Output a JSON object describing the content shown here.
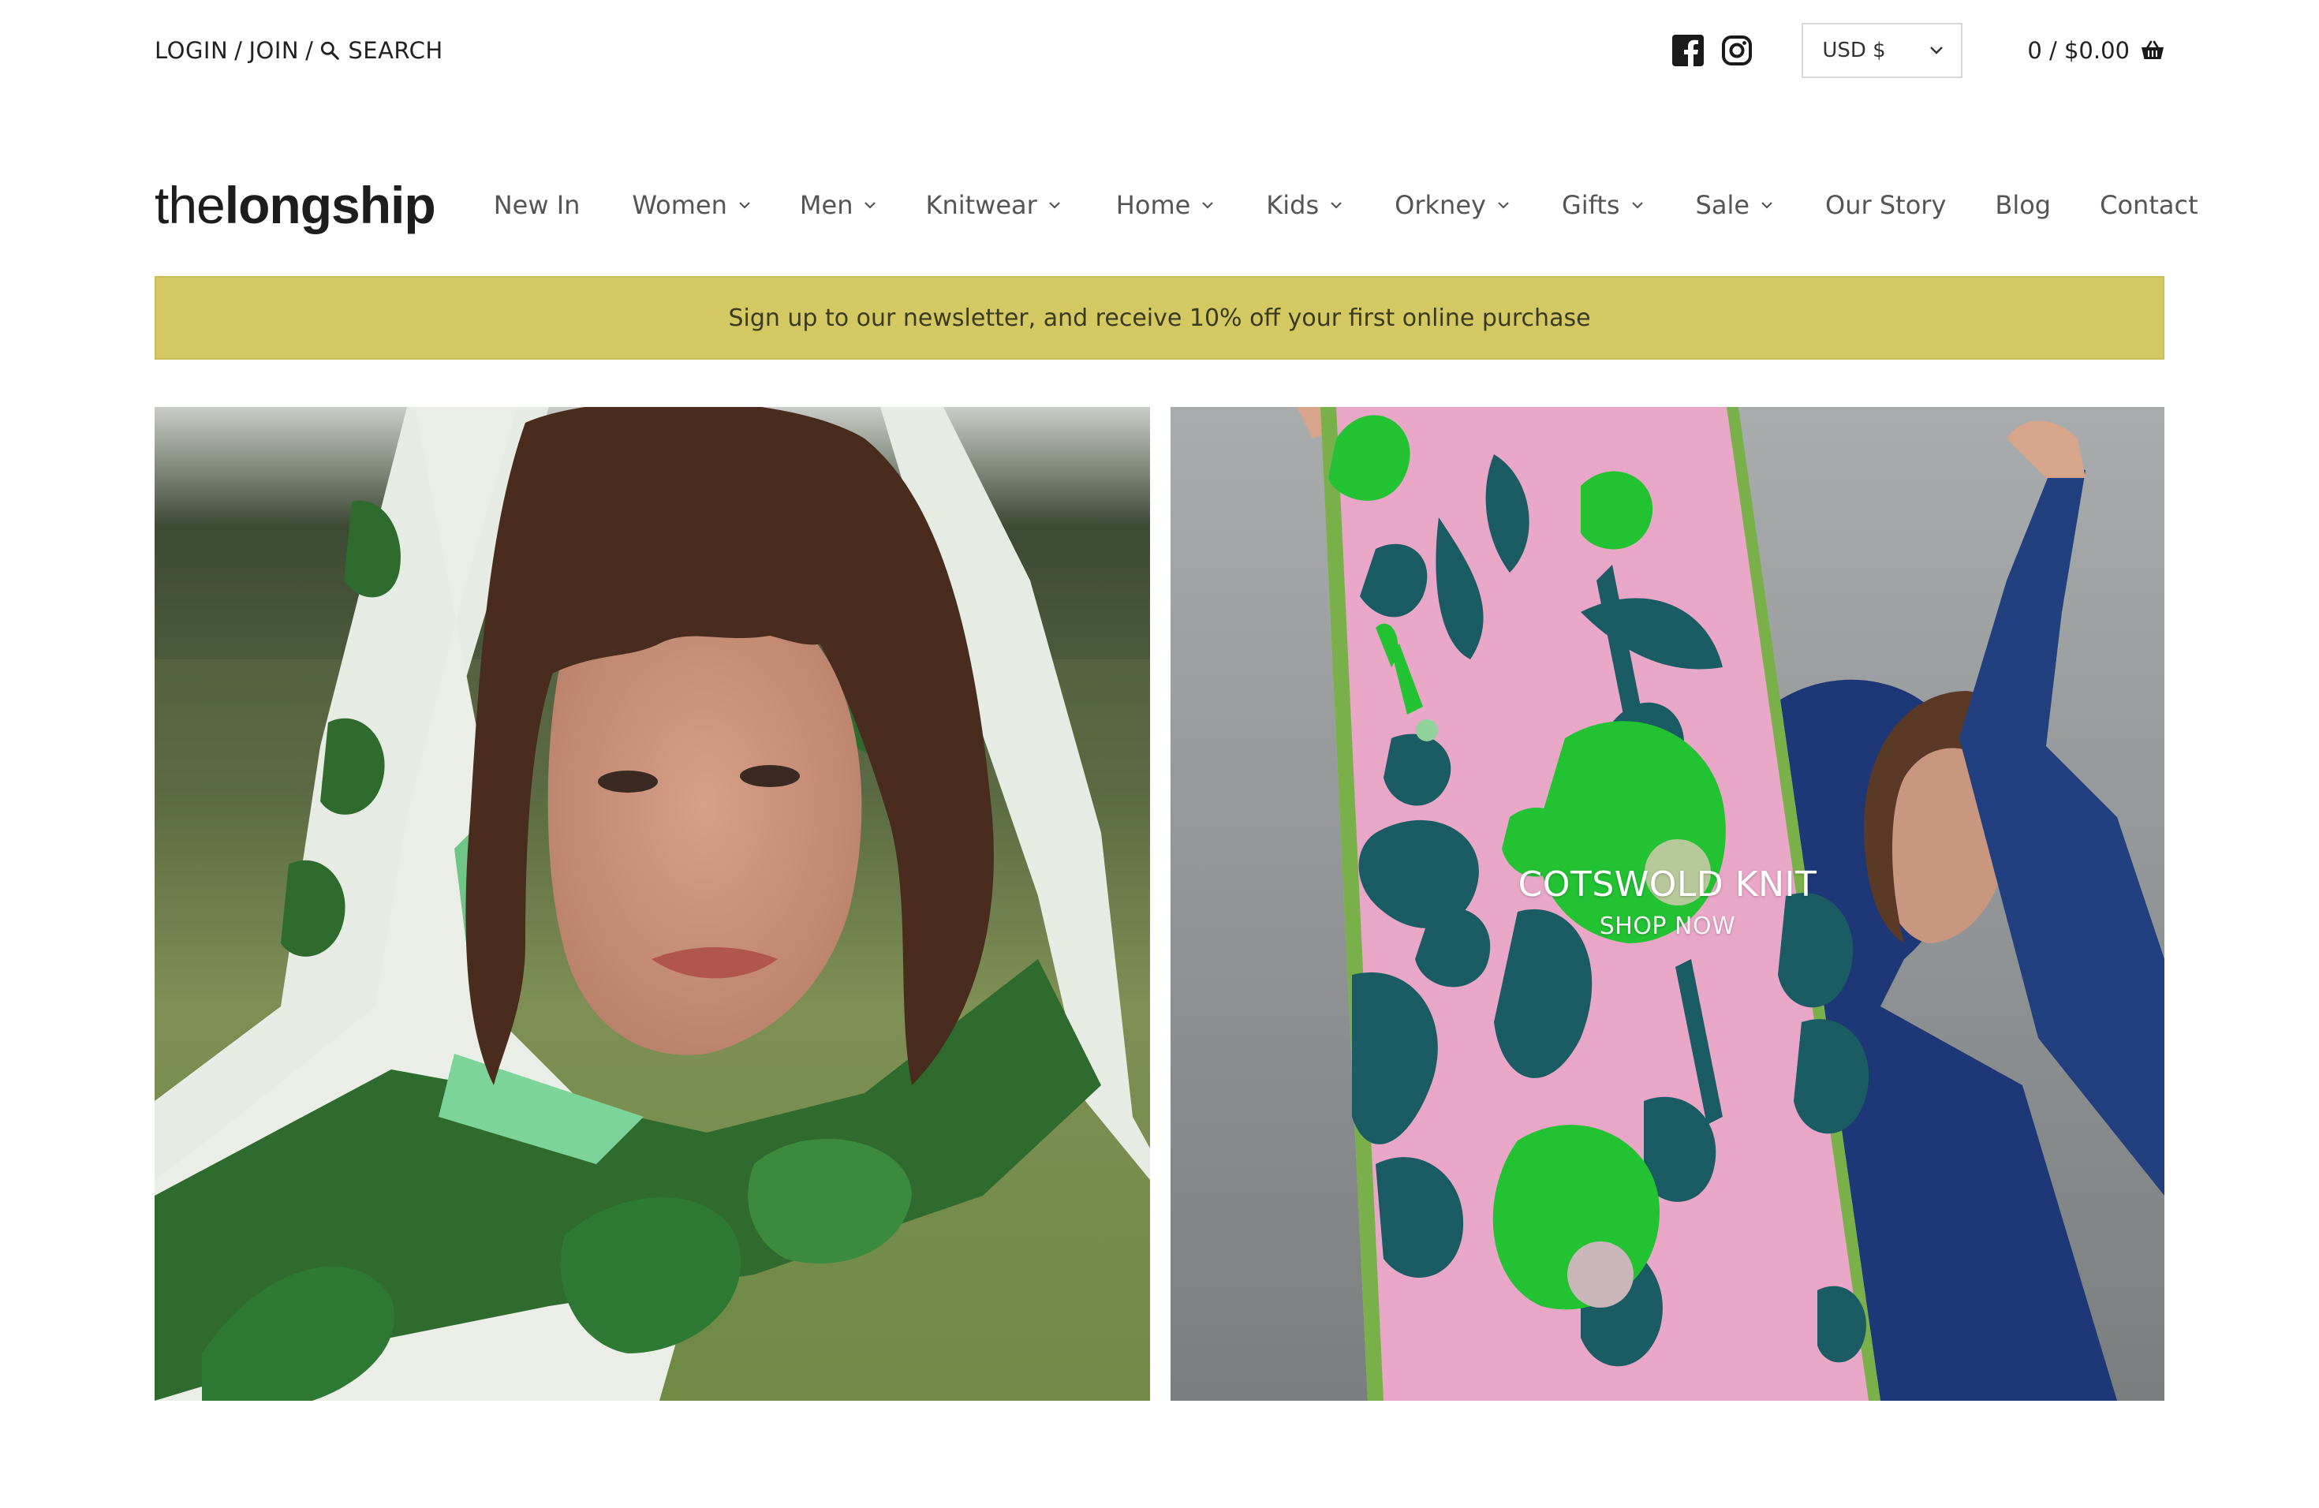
{
  "topbar": {
    "login": "LOGIN",
    "join": "JOIN",
    "search": "SEARCH",
    "currency": "USD $",
    "cart": "0 / $0.00"
  },
  "header": {
    "logo_light": "the",
    "logo_bold": "longship",
    "nav": [
      {
        "label": "New In",
        "dropdown": false
      },
      {
        "label": "Women",
        "dropdown": true
      },
      {
        "label": "Men",
        "dropdown": true
      },
      {
        "label": "Knitwear",
        "dropdown": true
      },
      {
        "label": "Home",
        "dropdown": true
      },
      {
        "label": "Kids",
        "dropdown": true
      },
      {
        "label": "Orkney",
        "dropdown": true
      },
      {
        "label": "Gifts",
        "dropdown": true
      },
      {
        "label": "Sale",
        "dropdown": true
      },
      {
        "label": "Our Story",
        "dropdown": false
      },
      {
        "label": "Blog",
        "dropdown": false
      },
      {
        "label": "Contact",
        "dropdown": false
      }
    ]
  },
  "banner": {
    "text": "Sign up to our newsletter, and receive 10% off your first online purchase",
    "color": "#d4c862"
  },
  "hero": {
    "right_title": "COTSWOLD KNIT",
    "right_cta": "SHOP NOW"
  },
  "icons": [
    "search-icon",
    "facebook-icon",
    "instagram-icon",
    "chevron-down-icon",
    "basket-icon"
  ]
}
